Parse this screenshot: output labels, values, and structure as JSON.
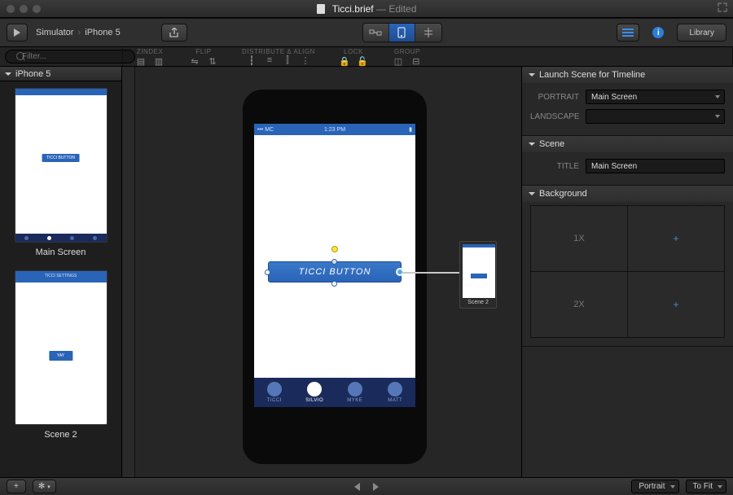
{
  "window": {
    "filename": "Ticci.brief",
    "status": "Edited"
  },
  "toolbar": {
    "simulator_label": "Simulator",
    "device": "iPhone 5",
    "library_label": "Library"
  },
  "toolbar2": {
    "search_placeholder": "Filter...",
    "groups": {
      "zindex": "ZINDEX",
      "flip": "FLIP",
      "distribute": "DISTRIBUTE\n& ALIGN",
      "lock": "LOCK",
      "group": "GROUP"
    }
  },
  "sidebar": {
    "device": "iPhone 5",
    "scenes": [
      {
        "label": "Main Screen"
      },
      {
        "label": "Scene 2"
      }
    ]
  },
  "canvas": {
    "status_bar": {
      "left": "••• MC",
      "mid": "1:23 PM",
      "right": "▮"
    },
    "button_label": "TICCI BUTTON",
    "tabs": [
      "TICCI",
      "SILVIO",
      "MYKE",
      "MATT"
    ],
    "active_tab": 1,
    "linked_scene": "Scene 2",
    "thumb1_btn": "TICCI BUTTON",
    "thumb2_title": "TICCI SETTINGS",
    "thumb2_btn": "YAY"
  },
  "inspector": {
    "sections": {
      "launch": "Launch Scene for Timeline",
      "scene": "Scene",
      "background": "Background"
    },
    "portrait_label": "PORTRAIT",
    "portrait_value": "Main Screen",
    "landscape_label": "LANDSCAPE",
    "landscape_value": "",
    "title_label": "TITLE",
    "title_value": "Main Screen",
    "bg_rows": [
      "1X",
      "2X"
    ]
  },
  "bottom": {
    "orientation": "Portrait",
    "zoom": "To Fit"
  }
}
